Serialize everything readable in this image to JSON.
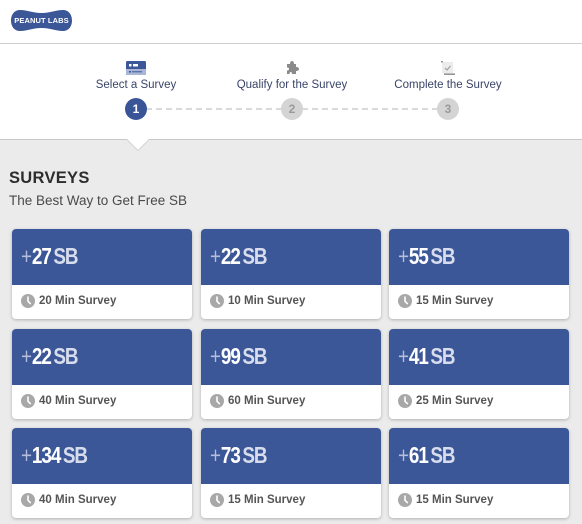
{
  "header": {
    "logo_text": "PEANUT LABS",
    "brand_color": "#3b5797"
  },
  "steps": [
    {
      "number": "1",
      "label": "Select a Survey",
      "icon": "survey-list-icon",
      "active": true
    },
    {
      "number": "2",
      "label": "Qualify for the Survey",
      "icon": "puzzle-icon",
      "active": false
    },
    {
      "number": "3",
      "label": "Complete the Survey",
      "icon": "checkmark-doc-icon",
      "active": false
    }
  ],
  "section": {
    "title": "SURVEYS",
    "subtitle": "The Best Way to Get Free SB"
  },
  "surveys": [
    {
      "plus": "+",
      "points": "27",
      "unit": "SB",
      "duration": "20 Min Survey"
    },
    {
      "plus": "+",
      "points": "22",
      "unit": "SB",
      "duration": "10 Min Survey"
    },
    {
      "plus": "+",
      "points": "55",
      "unit": "SB",
      "duration": "15 Min Survey"
    },
    {
      "plus": "+",
      "points": "22",
      "unit": "SB",
      "duration": "40 Min Survey"
    },
    {
      "plus": "+",
      "points": "99",
      "unit": "SB",
      "duration": "60 Min Survey"
    },
    {
      "plus": "+",
      "points": "41",
      "unit": "SB",
      "duration": "25 Min Survey"
    },
    {
      "plus": "+",
      "points": "134",
      "unit": "SB",
      "duration": "40 Min Survey"
    },
    {
      "plus": "+",
      "points": "73",
      "unit": "SB",
      "duration": "15 Min Survey"
    },
    {
      "plus": "+",
      "points": "61",
      "unit": "SB",
      "duration": "15 Min Survey"
    }
  ]
}
